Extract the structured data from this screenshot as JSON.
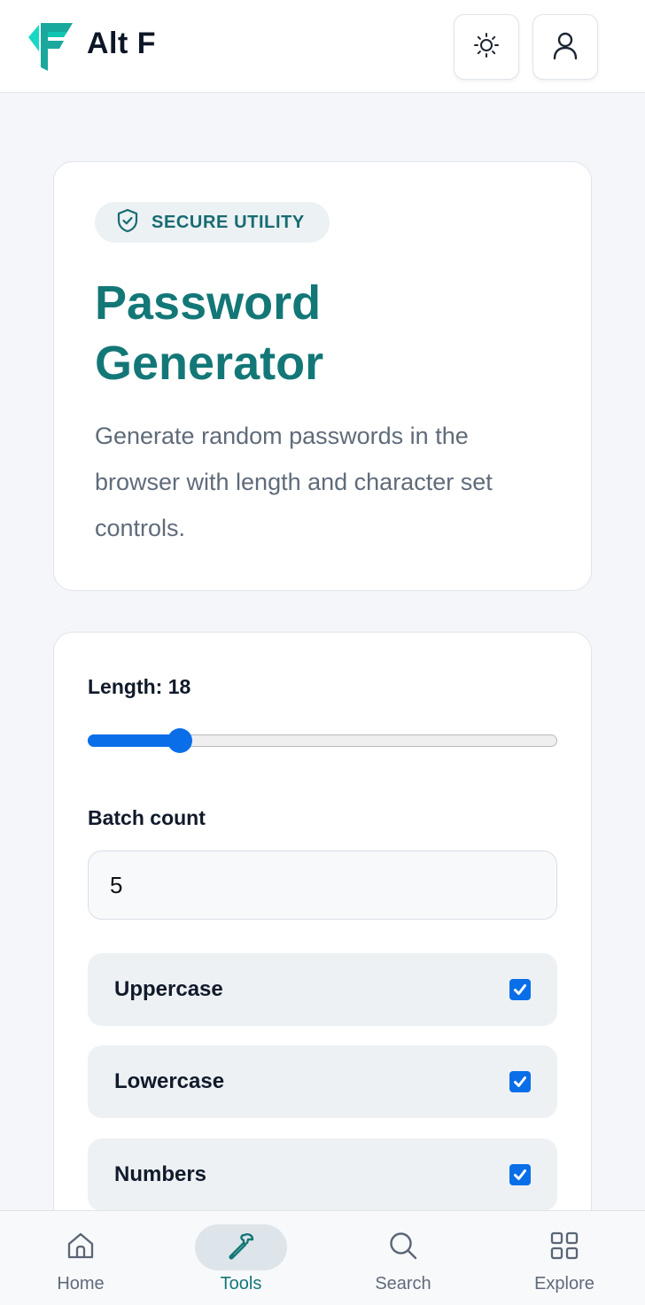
{
  "header": {
    "brand": "Alt F",
    "brand_color": "#1fb5a8",
    "theme_icon": "sun-icon",
    "account_icon": "user-icon"
  },
  "intro": {
    "badge_icon": "shield-check-icon",
    "badge": "SECURE UTILITY",
    "title": "Password Generator",
    "description": "Generate random passwords in the browser with length and character set controls."
  },
  "controls": {
    "length_label": "Length: 18",
    "length_value": 18,
    "length_min": 8,
    "length_max": 64,
    "batch_label": "Batch count",
    "batch_value": "5",
    "options": [
      {
        "label": "Uppercase",
        "checked": true
      },
      {
        "label": "Lowercase",
        "checked": true
      },
      {
        "label": "Numbers",
        "checked": true
      }
    ]
  },
  "bottom_nav": {
    "items": [
      {
        "label": "Home",
        "icon": "home-icon",
        "active": false
      },
      {
        "label": "Tools",
        "icon": "wrench-icon",
        "active": true
      },
      {
        "label": "Search",
        "icon": "search-icon",
        "active": false
      },
      {
        "label": "Explore",
        "icon": "grid-icon",
        "active": false
      }
    ]
  },
  "colors": {
    "accent": "#137777",
    "primary_blue": "#0a6ee8",
    "background": "#f4f6f9"
  }
}
